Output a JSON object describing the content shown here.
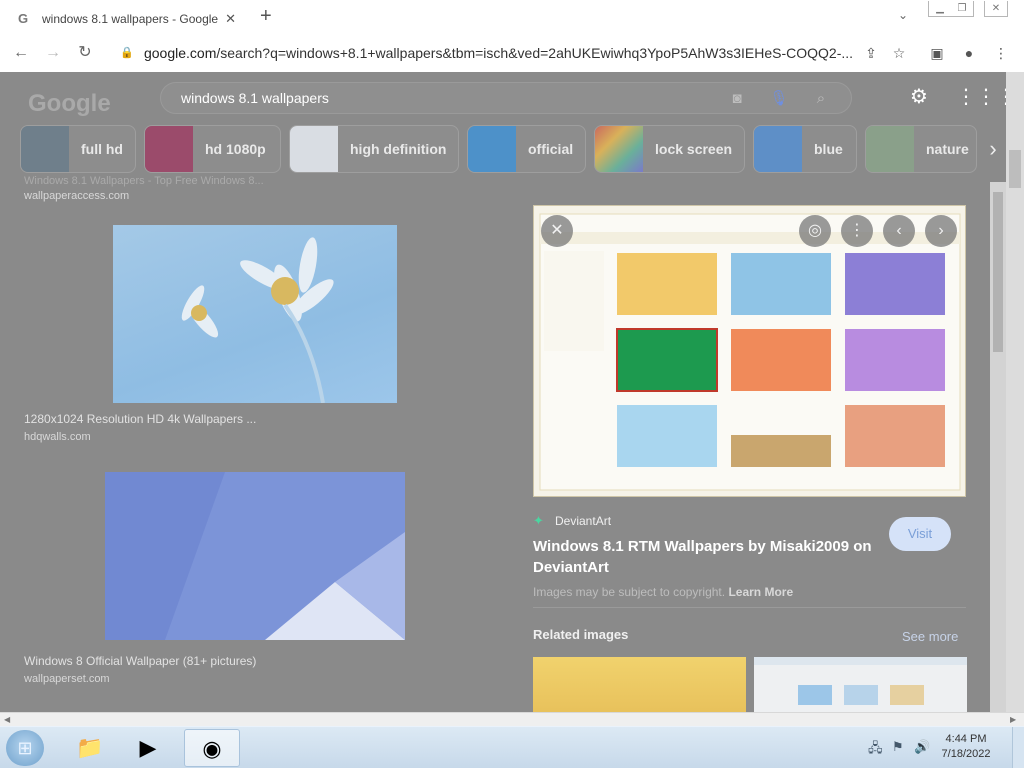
{
  "browser": {
    "tab": {
      "favicon": "G",
      "title": "windows 8.1 wallpapers - Google",
      "close": "✕"
    },
    "new_tab": "+",
    "url": {
      "host": "google.com",
      "path": "/search?q=windows+8.1+wallpapers&tbm=isch&ved=2ahUKEwiwhq3YpoP5AhW3s3IEHeS-COQQ2-..."
    }
  },
  "google": {
    "logo": "Google",
    "query": "windows 8.1 wallpapers",
    "chips": [
      {
        "label": "full hd",
        "thumb": "#6f7f8b"
      },
      {
        "label": "hd 1080p",
        "thumb": "#9b4b6b"
      },
      {
        "label": "high definition",
        "thumb": "#d9dde3"
      },
      {
        "label": "official",
        "thumb": "#4d91c9"
      },
      {
        "label": "lock screen",
        "thumb": "#c59a6a"
      },
      {
        "label": "blue",
        "thumb": "#5e8fc7"
      },
      {
        "label": "nature",
        "thumb": "#8aa08a"
      }
    ]
  },
  "results": {
    "cut_title": "Windows 8.1 Wallpapers - Top Free Windows 8...",
    "items": [
      {
        "source": "wallpaperaccess.com"
      },
      {
        "title": "1280x1024 Resolution HD 4k Wallpapers ...",
        "source": "hdqwalls.com"
      },
      {
        "title": "Windows 8 Official Wallpaper (81+ pictures)",
        "source": "wallpaperset.com"
      }
    ]
  },
  "preview": {
    "site": "DeviantArt",
    "title": "Windows 8.1 RTM Wallpapers by Misaki2009 on DeviantArt",
    "visit": "Visit",
    "note": "Images may be subject to copyright.",
    "learn_more": "Learn More",
    "related": "Related images",
    "see_more": "See more"
  },
  "taskbar": {
    "time": "4:44 PM",
    "date": "7/18/2022"
  },
  "colors": {
    "overlay_bg": "#8a8a8a",
    "visit_bg": "#d5e2f8",
    "taskbar": "#c7d9ea"
  }
}
